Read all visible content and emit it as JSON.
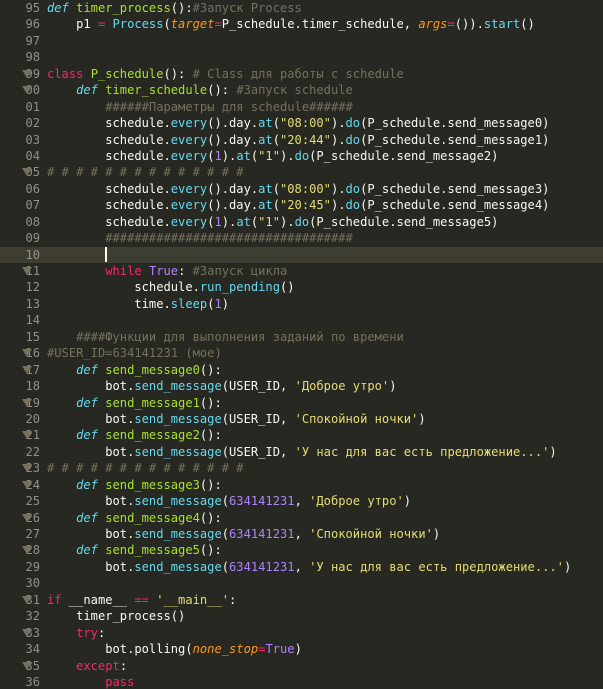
{
  "editor": {
    "colors": {
      "background": "#272822",
      "current_line": "#3e3d32",
      "gutter": "#90908a",
      "keyword": "#f92672",
      "function": "#a6e22e",
      "string": "#e6db74",
      "number": "#ae81ff",
      "comment": "#75715e",
      "builtin": "#66d9ef",
      "param": "#fd971f"
    },
    "icons": {
      "fold_marker": "fold-arrow-icon"
    },
    "lines": [
      {
        "num": "95",
        "fold": false,
        "tokens": [
          [
            "def",
            "def"
          ],
          [
            "txt",
            " "
          ],
          [
            "fn",
            "timer_process"
          ],
          [
            "txt",
            "():"
          ],
          [
            "cm",
            "#Запуск Process"
          ]
        ]
      },
      {
        "num": "96",
        "fold": false,
        "tokens": [
          [
            "txt",
            "    p1 "
          ],
          [
            "kw",
            "="
          ],
          [
            "txt",
            " "
          ],
          [
            "cls",
            "Process"
          ],
          [
            "txt",
            "("
          ],
          [
            "param",
            "target"
          ],
          [
            "kw",
            "="
          ],
          [
            "txt",
            "P_schedule.timer_schedule, "
          ],
          [
            "param",
            "args"
          ],
          [
            "kw",
            "="
          ],
          [
            "txt",
            "())."
          ],
          [
            "cls",
            "start"
          ],
          [
            "txt",
            "()"
          ]
        ]
      },
      {
        "num": "97",
        "fold": false,
        "tokens": []
      },
      {
        "num": "98",
        "fold": false,
        "tokens": []
      },
      {
        "num": "99",
        "fold": true,
        "tokens": [
          [
            "kw",
            "class"
          ],
          [
            "txt",
            " "
          ],
          [
            "fn",
            "P_schedule"
          ],
          [
            "txt",
            "(): "
          ],
          [
            "cm",
            "# Class для работы с schedule"
          ]
        ]
      },
      {
        "num": "00",
        "fold": true,
        "tokens": [
          [
            "txt",
            "    "
          ],
          [
            "def",
            "def"
          ],
          [
            "txt",
            " "
          ],
          [
            "fn",
            "timer_schedule"
          ],
          [
            "txt",
            "(): "
          ],
          [
            "cm",
            "#Запуск schedule"
          ]
        ]
      },
      {
        "num": "01",
        "fold": false,
        "tokens": [
          [
            "txt",
            "        "
          ],
          [
            "cm",
            "######Параметры для schedule######"
          ]
        ]
      },
      {
        "num": "02",
        "fold": false,
        "tokens": [
          [
            "txt",
            "        schedule."
          ],
          [
            "cls",
            "every"
          ],
          [
            "txt",
            "()."
          ],
          [
            "txt",
            "day."
          ],
          [
            "cls",
            "at"
          ],
          [
            "txt",
            "("
          ],
          [
            "str",
            "\"08:00\""
          ],
          [
            "txt",
            ")."
          ],
          [
            "cls",
            "do"
          ],
          [
            "txt",
            "(P_schedule.send_message0)"
          ]
        ]
      },
      {
        "num": "03",
        "fold": false,
        "tokens": [
          [
            "txt",
            "        schedule."
          ],
          [
            "cls",
            "every"
          ],
          [
            "txt",
            "()."
          ],
          [
            "txt",
            "day."
          ],
          [
            "cls",
            "at"
          ],
          [
            "txt",
            "("
          ],
          [
            "str",
            "\"20:44\""
          ],
          [
            "txt",
            ")."
          ],
          [
            "cls",
            "do"
          ],
          [
            "txt",
            "(P_schedule.send_message1)"
          ]
        ]
      },
      {
        "num": "04",
        "fold": false,
        "tokens": [
          [
            "txt",
            "        schedule."
          ],
          [
            "cls",
            "every"
          ],
          [
            "txt",
            "("
          ],
          [
            "num",
            "1"
          ],
          [
            "txt",
            ")."
          ],
          [
            "cls",
            "at"
          ],
          [
            "txt",
            "("
          ],
          [
            "str",
            "\"1\""
          ],
          [
            "txt",
            ")."
          ],
          [
            "cls",
            "do"
          ],
          [
            "txt",
            "(P_schedule.send_message2)"
          ]
        ]
      },
      {
        "num": "05",
        "fold": true,
        "tokens": [
          [
            "cm",
            "# # # # # # # # # # # # # #"
          ]
        ]
      },
      {
        "num": "06",
        "fold": false,
        "tokens": [
          [
            "txt",
            "        schedule."
          ],
          [
            "cls",
            "every"
          ],
          [
            "txt",
            "()."
          ],
          [
            "txt",
            "day."
          ],
          [
            "cls",
            "at"
          ],
          [
            "txt",
            "("
          ],
          [
            "str",
            "\"08:00\""
          ],
          [
            "txt",
            ")."
          ],
          [
            "cls",
            "do"
          ],
          [
            "txt",
            "(P_schedule.send_message3)"
          ]
        ]
      },
      {
        "num": "07",
        "fold": false,
        "tokens": [
          [
            "txt",
            "        schedule."
          ],
          [
            "cls",
            "every"
          ],
          [
            "txt",
            "()."
          ],
          [
            "txt",
            "day."
          ],
          [
            "cls",
            "at"
          ],
          [
            "txt",
            "("
          ],
          [
            "str",
            "\"20:45\""
          ],
          [
            "txt",
            ")."
          ],
          [
            "cls",
            "do"
          ],
          [
            "txt",
            "(P_schedule.send_message4)"
          ]
        ]
      },
      {
        "num": "08",
        "fold": false,
        "tokens": [
          [
            "txt",
            "        schedule."
          ],
          [
            "cls",
            "every"
          ],
          [
            "txt",
            "("
          ],
          [
            "num",
            "1"
          ],
          [
            "txt",
            ")."
          ],
          [
            "cls",
            "at"
          ],
          [
            "txt",
            "("
          ],
          [
            "str",
            "\"1\""
          ],
          [
            "txt",
            ")."
          ],
          [
            "cls",
            "do"
          ],
          [
            "txt",
            "(P_schedule.send_message5)"
          ]
        ]
      },
      {
        "num": "09",
        "fold": false,
        "tokens": [
          [
            "txt",
            "        "
          ],
          [
            "cm",
            "##################################"
          ]
        ]
      },
      {
        "num": "10",
        "fold": false,
        "current": true,
        "caret": true,
        "tokens": [
          [
            "txt",
            "        "
          ]
        ]
      },
      {
        "num": "11",
        "fold": true,
        "tokens": [
          [
            "txt",
            "        "
          ],
          [
            "kw",
            "while"
          ],
          [
            "txt",
            " "
          ],
          [
            "num",
            "True"
          ],
          [
            "txt",
            ": "
          ],
          [
            "cm",
            "#Запуск цикла"
          ]
        ]
      },
      {
        "num": "12",
        "fold": false,
        "tokens": [
          [
            "txt",
            "            schedule."
          ],
          [
            "cls",
            "run_pending"
          ],
          [
            "txt",
            "()"
          ]
        ]
      },
      {
        "num": "13",
        "fold": false,
        "tokens": [
          [
            "txt",
            "            time."
          ],
          [
            "cls",
            "sleep"
          ],
          [
            "txt",
            "("
          ],
          [
            "num",
            "1"
          ],
          [
            "txt",
            ")"
          ]
        ]
      },
      {
        "num": "14",
        "fold": false,
        "tokens": []
      },
      {
        "num": "15",
        "fold": false,
        "tokens": [
          [
            "txt",
            "    "
          ],
          [
            "cm",
            "####Функции для выполнения заданий по времени"
          ]
        ]
      },
      {
        "num": "16",
        "fold": true,
        "tokens": [
          [
            "cm",
            "#USER_ID=634141231 (мое)"
          ]
        ]
      },
      {
        "num": "17",
        "fold": true,
        "tokens": [
          [
            "txt",
            "    "
          ],
          [
            "def",
            "def"
          ],
          [
            "txt",
            " "
          ],
          [
            "fn",
            "send_message0"
          ],
          [
            "txt",
            "():"
          ]
        ]
      },
      {
        "num": "18",
        "fold": false,
        "tokens": [
          [
            "txt",
            "        bot."
          ],
          [
            "cls",
            "send_message"
          ],
          [
            "txt",
            "(USER_ID, "
          ],
          [
            "str",
            "'Доброе утро'"
          ],
          [
            "txt",
            ")"
          ]
        ]
      },
      {
        "num": "19",
        "fold": true,
        "tokens": [
          [
            "txt",
            "    "
          ],
          [
            "def",
            "def"
          ],
          [
            "txt",
            " "
          ],
          [
            "fn",
            "send_message1"
          ],
          [
            "txt",
            "():"
          ]
        ]
      },
      {
        "num": "20",
        "fold": false,
        "tokens": [
          [
            "txt",
            "        bot."
          ],
          [
            "cls",
            "send_message"
          ],
          [
            "txt",
            "(USER_ID, "
          ],
          [
            "str",
            "'Спокойной ночки'"
          ],
          [
            "txt",
            ")"
          ]
        ]
      },
      {
        "num": "21",
        "fold": true,
        "tokens": [
          [
            "txt",
            "    "
          ],
          [
            "def",
            "def"
          ],
          [
            "txt",
            " "
          ],
          [
            "fn",
            "send_message2"
          ],
          [
            "txt",
            "():"
          ]
        ]
      },
      {
        "num": "22",
        "fold": false,
        "tokens": [
          [
            "txt",
            "        bot."
          ],
          [
            "cls",
            "send_message"
          ],
          [
            "txt",
            "(USER_ID, "
          ],
          [
            "str",
            "'У нас для вас есть предложение...'"
          ],
          [
            "txt",
            ")"
          ]
        ]
      },
      {
        "num": "23",
        "fold": true,
        "tokens": [
          [
            "cm",
            "# # # # # # # # # # # # # #"
          ]
        ]
      },
      {
        "num": "24",
        "fold": true,
        "tokens": [
          [
            "txt",
            "    "
          ],
          [
            "def",
            "def"
          ],
          [
            "txt",
            " "
          ],
          [
            "fn",
            "send_message3"
          ],
          [
            "txt",
            "():"
          ]
        ]
      },
      {
        "num": "25",
        "fold": false,
        "tokens": [
          [
            "txt",
            "        bot."
          ],
          [
            "cls",
            "send_message"
          ],
          [
            "txt",
            "("
          ],
          [
            "num",
            "634141231"
          ],
          [
            "txt",
            ", "
          ],
          [
            "str",
            "'Доброе утро'"
          ],
          [
            "txt",
            ")"
          ]
        ]
      },
      {
        "num": "26",
        "fold": true,
        "tokens": [
          [
            "txt",
            "    "
          ],
          [
            "def",
            "def"
          ],
          [
            "txt",
            " "
          ],
          [
            "fn",
            "send_message4"
          ],
          [
            "txt",
            "():"
          ]
        ]
      },
      {
        "num": "27",
        "fold": false,
        "tokens": [
          [
            "txt",
            "        bot."
          ],
          [
            "cls",
            "send_message"
          ],
          [
            "txt",
            "("
          ],
          [
            "num",
            "634141231"
          ],
          [
            "txt",
            ", "
          ],
          [
            "str",
            "'Спокойной ночки'"
          ],
          [
            "txt",
            ")"
          ]
        ]
      },
      {
        "num": "28",
        "fold": true,
        "tokens": [
          [
            "txt",
            "    "
          ],
          [
            "def",
            "def"
          ],
          [
            "txt",
            " "
          ],
          [
            "fn",
            "send_message5"
          ],
          [
            "txt",
            "():"
          ]
        ]
      },
      {
        "num": "29",
        "fold": false,
        "tokens": [
          [
            "txt",
            "        bot."
          ],
          [
            "cls",
            "send_message"
          ],
          [
            "txt",
            "("
          ],
          [
            "num",
            "634141231"
          ],
          [
            "txt",
            ", "
          ],
          [
            "str",
            "'У нас для вас есть предложение...'"
          ],
          [
            "txt",
            ")"
          ]
        ]
      },
      {
        "num": "30",
        "fold": false,
        "tokens": []
      },
      {
        "num": "31",
        "fold": true,
        "tokens": [
          [
            "kw",
            "if"
          ],
          [
            "txt",
            " __name__ "
          ],
          [
            "kw",
            "=="
          ],
          [
            "txt",
            " "
          ],
          [
            "str",
            "'__main__'"
          ],
          [
            "txt",
            ":"
          ]
        ]
      },
      {
        "num": "32",
        "fold": false,
        "tokens": [
          [
            "txt",
            "    timer_process()"
          ]
        ]
      },
      {
        "num": "33",
        "fold": true,
        "tokens": [
          [
            "txt",
            "    "
          ],
          [
            "kw",
            "try"
          ],
          [
            "txt",
            ":"
          ]
        ]
      },
      {
        "num": "34",
        "fold": false,
        "tokens": [
          [
            "txt",
            "        bot.polling("
          ],
          [
            "param",
            "none_stop"
          ],
          [
            "kw",
            "="
          ],
          [
            "num",
            "True"
          ],
          [
            "txt",
            ")"
          ]
        ]
      },
      {
        "num": "35",
        "fold": true,
        "tokens": [
          [
            "txt",
            "    "
          ],
          [
            "kw",
            "except"
          ],
          [
            "txt",
            ":"
          ]
        ]
      },
      {
        "num": "36",
        "fold": false,
        "tokens": [
          [
            "txt",
            "        "
          ],
          [
            "kw",
            "pass"
          ]
        ]
      }
    ]
  }
}
